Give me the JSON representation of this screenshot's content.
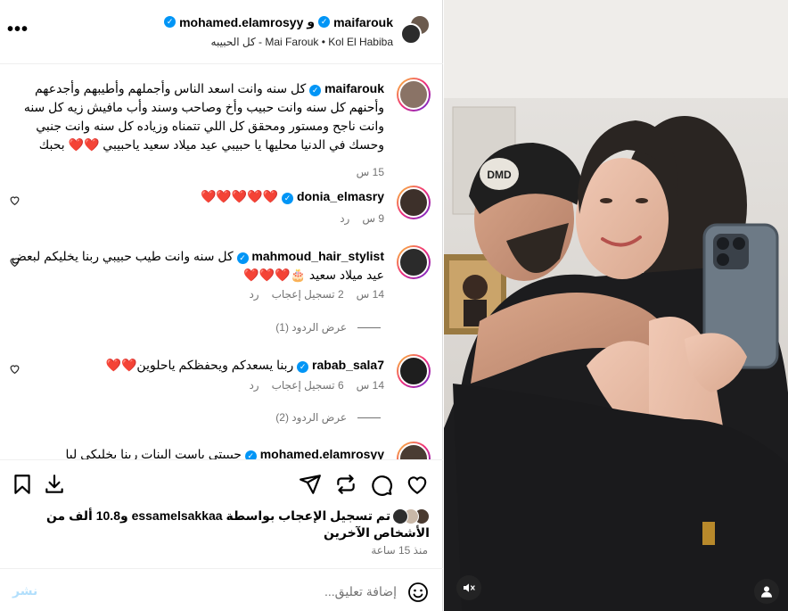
{
  "header": {
    "user1": "maifarouk",
    "connector": "و",
    "user2": "mohamed.elamrosyy",
    "audio": "Mai Farouk • Kol El Habiba - كل الحبيبه",
    "more_icon": "more-dots-icon"
  },
  "caption": {
    "user": "maifarouk",
    "text": "كل سنه وانت اسعد الناس وأجملهم وأطيبهم وأجدعهم وأحنهم كل سنه وانت حبيب وأخ وصاحب وسند وأب مافيش زيه كل سنه وانت ناجح ومستور ومحقق كل اللي تتمناه وزياده كل سنه وانت جنبي وحسك في الدنيا محليها يا حبيبي عيد ميلاد سعيد ياحبيبي ❤️❤️ بحبك",
    "time": "15 س"
  },
  "comments": [
    {
      "user": "donia_elmasry",
      "text": "❤️❤️❤️❤️❤️",
      "time": "9 س",
      "likes": "",
      "reply": "رد"
    },
    {
      "user": "mahmoud_hair_stylist",
      "text": "كل سنه وانت طيب حبيبي ربنا يخليكم لبعض عيد ميلاد سعيد 🎂❤️❤️❤️",
      "time": "14 س",
      "likes": "2 تسجيل إعجاب",
      "reply": "رد",
      "replies": "عرض الردود (1)"
    },
    {
      "user": "rabab_sala7",
      "text": "ربنا يسعدكم ويحفظكم ياحلوين❤️❤️",
      "time": "14 س",
      "likes": "6 تسجيل إعجاب",
      "reply": "رد",
      "replies": "عرض الردود (2)"
    },
    {
      "user": "mohamed.elamrosyy",
      "text": "حبيبتي ياست البنات ربنا يخليكي ليا",
      "time": "",
      "likes": "",
      "reply": ""
    }
  ],
  "likes_summary": "تم تسجيل الإعجاب بواسطة essamelsakkaa و10.8 ألف من الأشخاص الآخرين",
  "posted_ago": "منذ 15 ساعة",
  "add_comment": {
    "placeholder": "إضافة تعليق...",
    "post_label": "نشر"
  },
  "colors": {
    "verified": "#0095f6",
    "heart": "#ed4956",
    "post_disabled": "#b2dffc"
  }
}
